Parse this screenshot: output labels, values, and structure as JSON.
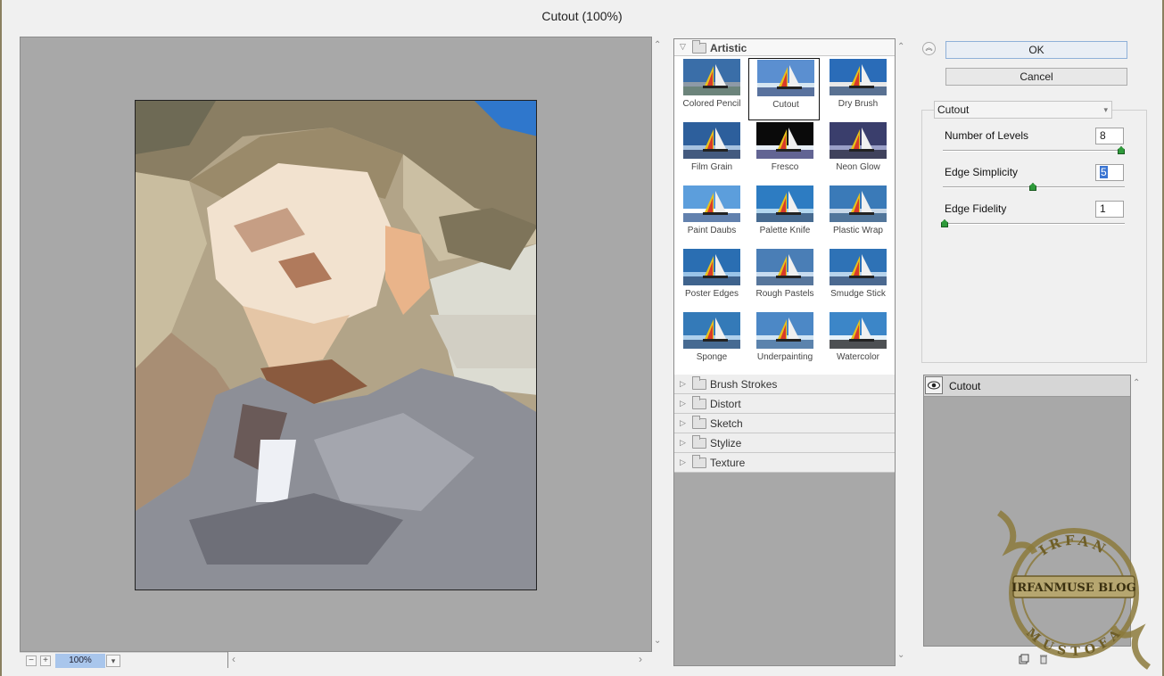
{
  "window": {
    "title": "Cutout (100%)"
  },
  "preview": {
    "zoom": "100%"
  },
  "gallery": {
    "open_category": "Artistic",
    "filters": [
      {
        "label": "Colored Pencil"
      },
      {
        "label": "Cutout"
      },
      {
        "label": "Dry Brush"
      },
      {
        "label": "Film Grain"
      },
      {
        "label": "Fresco"
      },
      {
        "label": "Neon Glow"
      },
      {
        "label": "Paint Daubs"
      },
      {
        "label": "Palette Knife"
      },
      {
        "label": "Plastic Wrap"
      },
      {
        "label": "Poster Edges"
      },
      {
        "label": "Rough Pastels"
      },
      {
        "label": "Smudge Stick"
      },
      {
        "label": "Sponge"
      },
      {
        "label": "Underpainting"
      },
      {
        "label": "Watercolor"
      }
    ],
    "selected_filter": "Cutout",
    "categories": [
      "Brush Strokes",
      "Distort",
      "Sketch",
      "Stylize",
      "Texture"
    ]
  },
  "buttons": {
    "ok": "OK",
    "cancel": "Cancel"
  },
  "settings": {
    "filter": "Cutout",
    "params": [
      {
        "label": "Number of Levels",
        "value": "8",
        "slider": 1.0
      },
      {
        "label": "Edge Simplicity",
        "value": "5",
        "slider": 0.5
      },
      {
        "label": "Edge Fidelity",
        "value": "1",
        "slider": 0.0
      }
    ]
  },
  "layers": {
    "items": [
      {
        "name": "Cutout"
      }
    ]
  },
  "watermark": {
    "top": "IRFAN",
    "middle": "IRFANMUSE BLOG",
    "bottom": "MUSTOFA"
  },
  "colors": {
    "accent": "#3b75d2",
    "panel": "#a8a8a8",
    "knob": "#2e9a3a"
  }
}
